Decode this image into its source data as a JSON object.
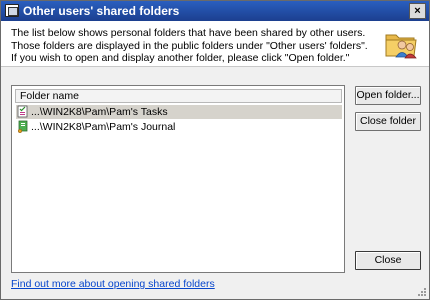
{
  "window": {
    "title": "Other users' shared folders",
    "close_label": "×"
  },
  "header": {
    "description": "The list below shows personal folders that have been shared by other users. Those folders are displayed in the public folders under \"Other users' folders\". If you wish to open and display another folder, please click \"Open folder.\""
  },
  "list": {
    "column_header": "Folder name",
    "rows": [
      {
        "label": "...\\WIN2K8\\Pam\\Pam's Tasks",
        "icon": "tasks-icon",
        "selected": true
      },
      {
        "label": "...\\WIN2K8\\Pam\\Pam's Journal",
        "icon": "journal-icon",
        "selected": false
      }
    ]
  },
  "buttons": {
    "open_folder": "Open folder...",
    "close_folder": "Close folder",
    "close": "Close"
  },
  "footer": {
    "help_link": "Find out more about opening shared folders"
  },
  "colors": {
    "titlebar": "#1c3f8f",
    "link": "#0645cc",
    "selection": "#d6d3cc"
  }
}
